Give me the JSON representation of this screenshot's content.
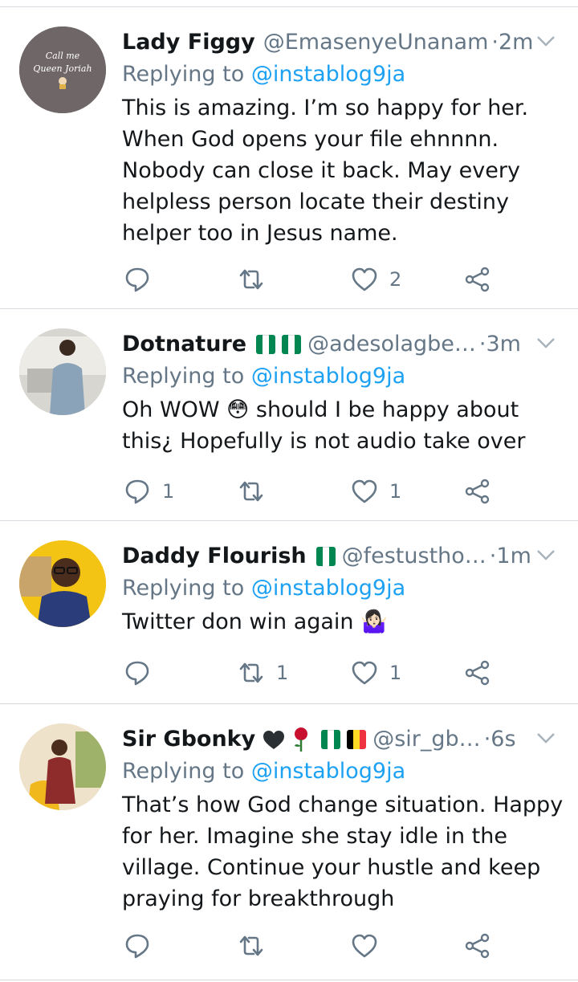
{
  "tweets": [
    {
      "name": "Lady Figgy",
      "handle": "@EmasenyeUnanam",
      "time": "2m",
      "replying_prefix": "Replying to",
      "replying_to": "@instablog9ja",
      "text": "This is amazing. I’m so happy for her. When God opens your file ehnnnn. Nobody can close it back. May every helpless person locate their destiny helper too in Jesus name.",
      "avatar_text": "Call me Queen Joriah",
      "replies": "",
      "retweets": "",
      "likes": "2"
    },
    {
      "name": "Dotnature",
      "handle": "@adesolagbe…",
      "time": "3m",
      "replying_prefix": "Replying to",
      "replying_to": "@instablog9ja",
      "text": "Oh WOW 😳 should I be happy about this¿ Hopefully is not audio take over",
      "replies": "1",
      "retweets": "",
      "likes": "1"
    },
    {
      "name": "Daddy Flourish",
      "handle": "@festustho…",
      "time": "1m",
      "replying_prefix": "Replying to",
      "replying_to": "@instablog9ja",
      "text": "Twitter don win again 🤷🏻‍♀️",
      "replies": "",
      "retweets": "1",
      "likes": "1"
    },
    {
      "name": "Sir Gbonky",
      "handle": "@sir_gb…",
      "time": "6s",
      "replying_prefix": "Replying to",
      "replying_to": "@instablog9ja",
      "text": "That’s how God change situation. Happy for her. Imagine she stay idle in the village. Continue your hustle and keep praying for breakthrough",
      "replies": "",
      "retweets": "",
      "likes": ""
    }
  ],
  "colors": {
    "handle_gray": "#657786",
    "mention_blue": "#1da1f2",
    "divider": "#d7dbdf",
    "nigeria_green": "#008751",
    "belgium_black": "#000000",
    "belgium_yellow": "#fdda24",
    "belgium_red": "#ef3340"
  }
}
